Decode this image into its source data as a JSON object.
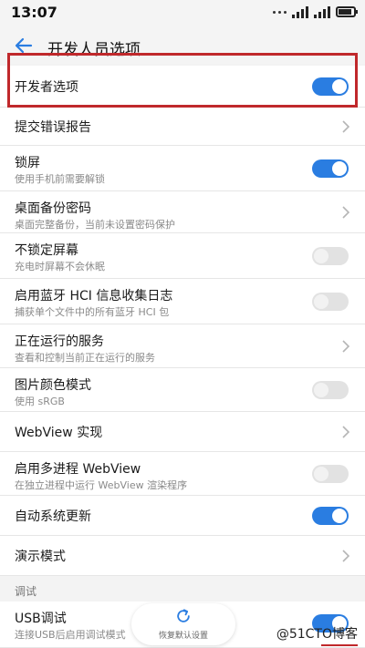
{
  "status": {
    "time": "13:07"
  },
  "header": {
    "title": "开发人员选项"
  },
  "rows": [
    {
      "label": "开发者选项",
      "sub": "",
      "control": "toggle",
      "on": true
    },
    {
      "label": "提交错误报告",
      "sub": "",
      "control": "chevron"
    },
    {
      "label": "锁屏",
      "sub": "使用手机前需要解锁",
      "control": "toggle",
      "on": true
    },
    {
      "label": "桌面备份密码",
      "sub": "桌面完整备份，当前未设置密码保护",
      "control": "chevron"
    },
    {
      "label": "不锁定屏幕",
      "sub": "充电时屏幕不会休眠",
      "control": "toggle",
      "on": false
    },
    {
      "label": "启用蓝牙 HCI 信息收集日志",
      "sub": "捕获单个文件中的所有蓝牙 HCI 包",
      "control": "toggle",
      "on": false
    },
    {
      "label": "正在运行的服务",
      "sub": "查看和控制当前正在运行的服务",
      "control": "chevron"
    },
    {
      "label": "图片颜色模式",
      "sub": "使用 sRGB",
      "control": "toggle",
      "on": false
    },
    {
      "label": "WebView 实现",
      "sub": "",
      "control": "chevron"
    },
    {
      "label": "启用多进程 WebView",
      "sub": "在独立进程中运行 WebView 渲染程序",
      "control": "toggle",
      "on": false
    },
    {
      "label": "自动系统更新",
      "sub": "",
      "control": "toggle",
      "on": true
    },
    {
      "label": "演示模式",
      "sub": "",
      "control": "chevron"
    }
  ],
  "section": {
    "header": "调试"
  },
  "usb": {
    "label": "USB调试",
    "sub": "连接USB后启用调试模式",
    "on": true
  },
  "restore": {
    "label": "恢复默认设置"
  },
  "watermark": "@51CTO博客",
  "colors": {
    "accent": "#2a7de1",
    "highlight": "#c0282b"
  },
  "icons": {
    "back": "arrow-left-icon",
    "chevron": "chevron-right-icon",
    "restore": "refresh-icon"
  }
}
